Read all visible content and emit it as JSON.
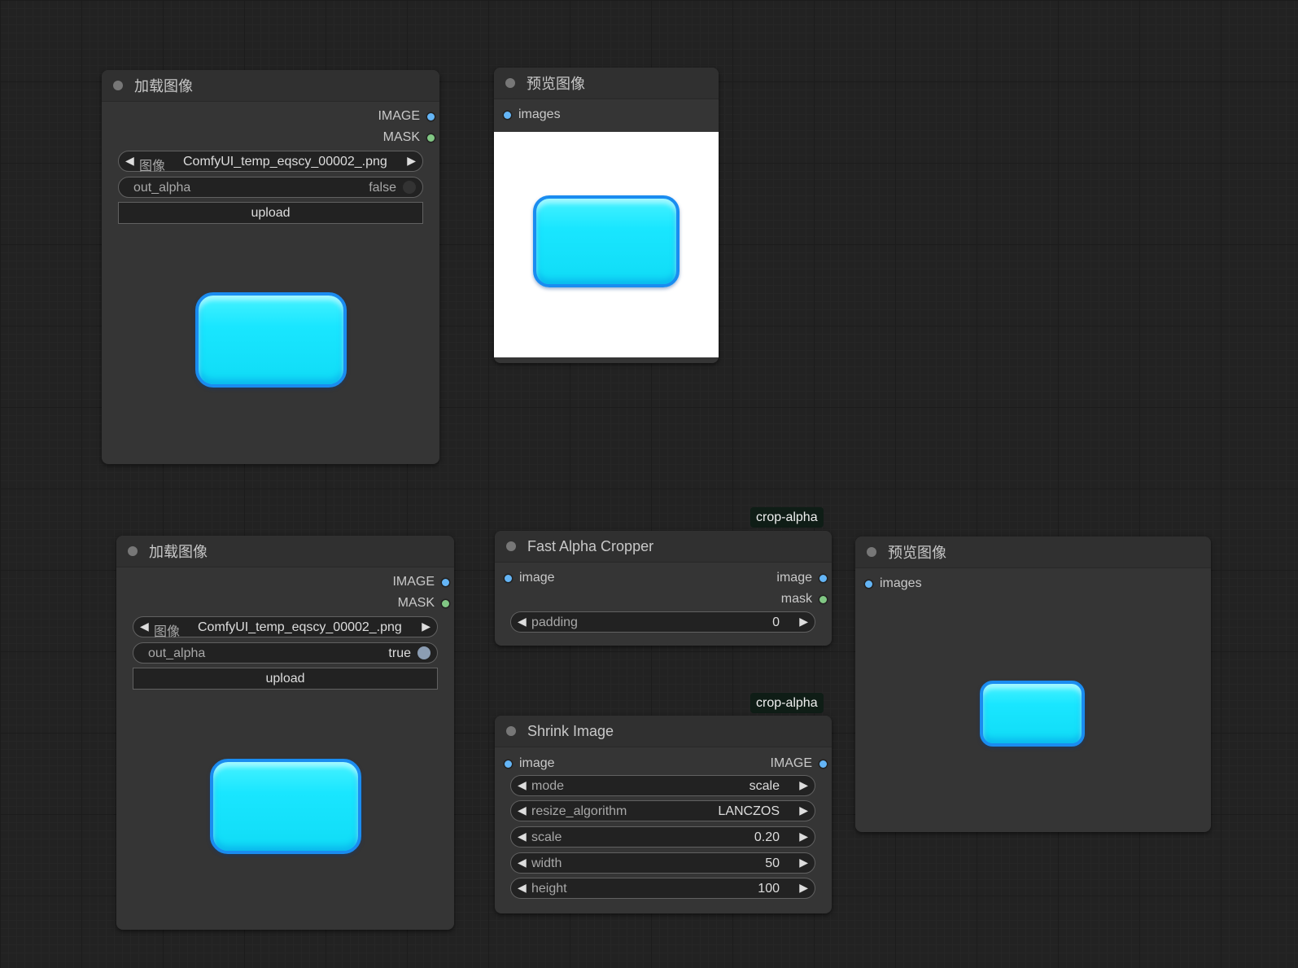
{
  "colors": {
    "canvas": "#222222",
    "node_bg": "#353535",
    "slot_image": "#64b5f6",
    "slot_mask": "#81c784",
    "preview_bg": "#ffffff",
    "blob_fill": "#19e6ff",
    "blob_border": "#1a8cf0",
    "group_tag_bg": "#0f1d16"
  },
  "load_image_1": {
    "title": "加载图像",
    "outputs": [
      "IMAGE",
      "MASK"
    ],
    "image_label": "图像",
    "image_value": "ComfyUI_temp_eqscy_00002_.png",
    "out_alpha_label": "out_alpha",
    "out_alpha_value": "false",
    "upload_label": "upload"
  },
  "preview_1": {
    "title": "预览图像",
    "input": "images"
  },
  "load_image_2": {
    "title": "加载图像",
    "outputs": [
      "IMAGE",
      "MASK"
    ],
    "image_label": "图像",
    "image_value": "ComfyUI_temp_eqscy_00002_.png",
    "out_alpha_label": "out_alpha",
    "out_alpha_value": "true",
    "upload_label": "upload"
  },
  "group_tags": [
    "crop-alpha",
    "crop-alpha"
  ],
  "fast_alpha_cropper": {
    "title": "Fast Alpha Cropper",
    "input": "image",
    "outputs": [
      "image",
      "mask"
    ],
    "padding_label": "padding",
    "padding_value": "0"
  },
  "shrink_image": {
    "title": "Shrink Image",
    "input": "image",
    "output": "IMAGE",
    "widgets": [
      {
        "label": "mode",
        "value": "scale"
      },
      {
        "label": "resize_algorithm",
        "value": "LANCZOS"
      },
      {
        "label": "scale",
        "value": "0.20"
      },
      {
        "label": "width",
        "value": "50"
      },
      {
        "label": "height",
        "value": "100"
      }
    ]
  },
  "preview_2": {
    "title": "预览图像",
    "input": "images"
  }
}
